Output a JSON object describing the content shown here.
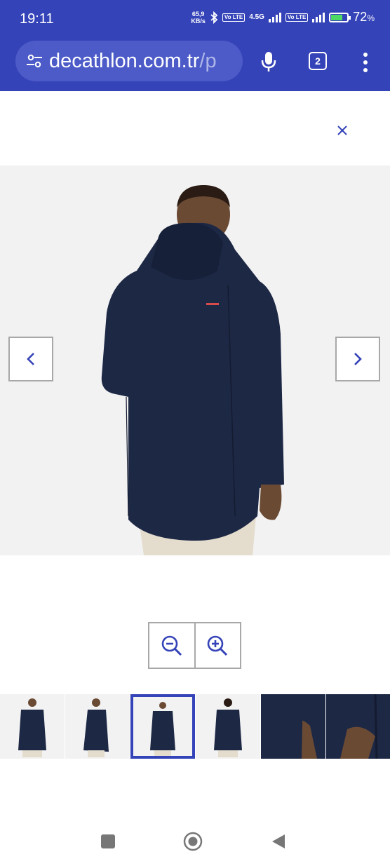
{
  "status_bar": {
    "time": "19:11",
    "speed_value": "65,9",
    "speed_unit": "KB/s",
    "volte1": "Vo LTE",
    "network": "4.5G",
    "volte2": "Vo LTE",
    "battery_percent": "72",
    "battery_suffix": "%",
    "battery_level": 0.72
  },
  "browser": {
    "url_main": "decathlon.com.tr",
    "url_rest": "/p",
    "tab_count": "2"
  },
  "gallery": {
    "close_icon": "close-icon",
    "prev_icon": "chevron-left-icon",
    "next_icon": "chevron-right-icon",
    "zoom_out_icon": "zoom-out-icon",
    "zoom_in_icon": "zoom-in-icon",
    "selected_thumbnail_index": 2,
    "thumbnail_count": 6
  },
  "colors": {
    "brand": "#3543b8",
    "jacket": "#1d2845"
  }
}
